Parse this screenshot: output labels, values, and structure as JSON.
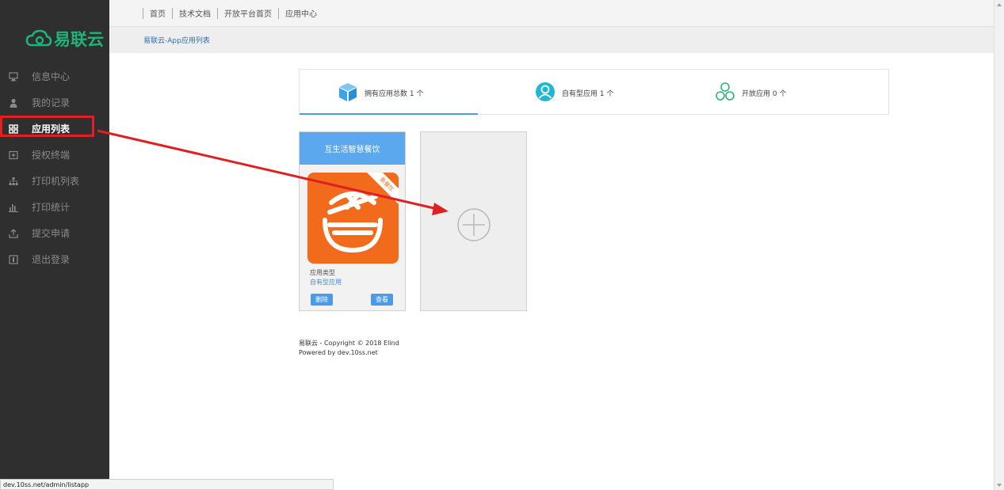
{
  "brand": {
    "name": "易联云",
    "color": "#1fb37a"
  },
  "topnav": [
    "首页",
    "技术文档",
    "开放平台首页",
    "应用中心"
  ],
  "breadcrumb": "易联云-App应用列表",
  "sidebar": {
    "items": [
      {
        "label": "信息中心",
        "icon": "monitor-icon"
      },
      {
        "label": "我的记录",
        "icon": "user-icon"
      },
      {
        "label": "应用列表",
        "icon": "grid-icon",
        "active": true
      },
      {
        "label": "授权终端",
        "icon": "plus-box-icon"
      },
      {
        "label": "打印机列表",
        "icon": "sitemap-icon"
      },
      {
        "label": "打印统计",
        "icon": "bar-chart-icon"
      },
      {
        "label": "提交申请",
        "icon": "upload-icon"
      },
      {
        "label": "退出登录",
        "icon": "logout-icon"
      }
    ]
  },
  "stats": {
    "total": "拥有应用总数 1 个",
    "own": "自有型应用 1 个",
    "open": "开放应用 0 个"
  },
  "app_card": {
    "title": "互生活智慧餐饮",
    "ribbon": "新餐饮",
    "type_label": "应用类型",
    "type_value": "自有型应用",
    "delete_label": "删除",
    "view_label": "查看"
  },
  "footer": {
    "line1": "易联云 - Copyright © 2018 Elind",
    "line2": "Powered by dev.10ss.net"
  },
  "status_url": "dev.10ss.net/admin/listapp",
  "colors": {
    "sidebar": "#2f2f2f",
    "accent": "#4a9be8",
    "highlight": "#e02020",
    "app_bg": "#f26a1c"
  }
}
